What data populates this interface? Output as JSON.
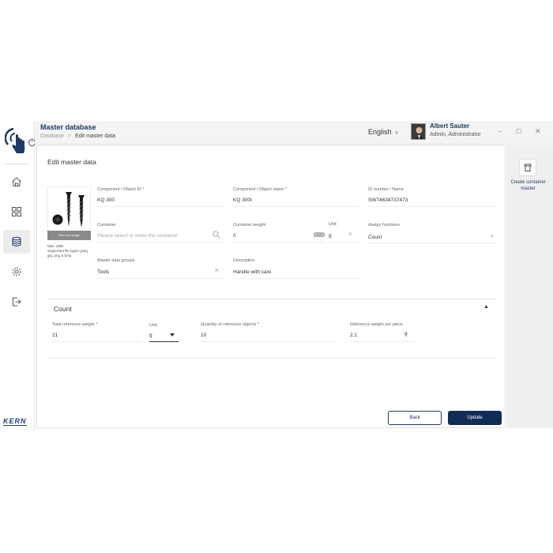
{
  "header": {
    "app_title": "Master database",
    "breadcrumb": [
      "Database",
      "Edit master data"
    ],
    "language": "English",
    "user_name": "Albert Sauter",
    "user_role": "Admin, Administrator"
  },
  "sidebar": {
    "items": [
      {
        "name": "home",
        "icon": "home-icon"
      },
      {
        "name": "apps",
        "icon": "grid-icon"
      },
      {
        "name": "database",
        "icon": "database-icon",
        "active": true
      },
      {
        "name": "settings",
        "icon": "gear-icon"
      },
      {
        "name": "logout",
        "icon": "logout-icon"
      }
    ],
    "brand": "KERN"
  },
  "panel": {
    "title": "Edit master data",
    "image": {
      "remove_label": "Remove image",
      "max_size": "Max. 2MB",
      "supported": "Supported file types: jpeg, jpg, png & bmp"
    },
    "fields": {
      "component_id": {
        "label": "Component / Object ID *",
        "value": "KQ 300"
      },
      "component_name": {
        "label": "Component / Object name *",
        "value": "KQ 300I"
      },
      "id_number": {
        "label": "ID number / Name",
        "value": "SW74634737473"
      },
      "container": {
        "label": "Container",
        "placeholder": "Please select or enter the container"
      },
      "container_weight": {
        "label": "Container weight",
        "value": "0"
      },
      "unit": {
        "label": "Unit",
        "value": "g"
      },
      "assign_functions": {
        "label": "Assign functions",
        "value": "Count"
      },
      "master_groups": {
        "label": "Master data groups",
        "value": "Tools"
      },
      "description": {
        "label": "Description",
        "value": "Handle with care"
      }
    },
    "count_section": {
      "title": "Count",
      "total_ref_weight": {
        "label": "Total reference weight *",
        "value": "21"
      },
      "unit": {
        "label": "Unit",
        "value": "g"
      },
      "quantity_ref": {
        "label": "Quantity of reference objects *",
        "value": "10"
      },
      "ref_weight_piece": {
        "label": "Reference weight per piece",
        "value": "2.1",
        "unit": "g"
      }
    },
    "buttons": {
      "back": "Back",
      "update": "Update"
    }
  },
  "right_rail": {
    "create_label": "Create container master"
  },
  "colors": {
    "brand_navy": "#0f2d57",
    "title_navy": "#1c3a66"
  }
}
